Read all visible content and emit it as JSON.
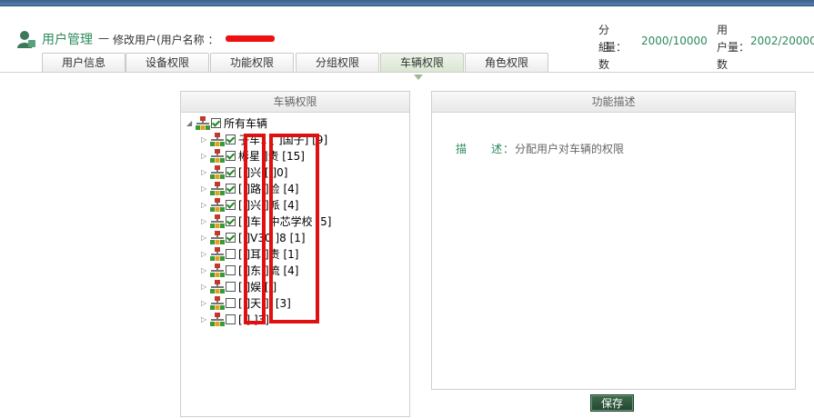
{
  "header": {
    "title": "用户管理",
    "separator": "—",
    "subtitle": "修改用户(用户名称 ：",
    "group_count_label_1": "分組数",
    "group_count_label_2": "量：",
    "group_count_value": "2000/10000",
    "user_count_label_1": "用户数",
    "user_count_label_2": "量：",
    "user_count_value": "2002/20000"
  },
  "tabs": [
    {
      "label": "用户信息"
    },
    {
      "label": "设备权限"
    },
    {
      "label": "功能权限"
    },
    {
      "label": "分组权限"
    },
    {
      "label": "车辆权限",
      "active": true
    },
    {
      "label": "角色权限"
    }
  ],
  "vehicle_panel": {
    "title": "车辆权限",
    "root": {
      "label": "所有车辆",
      "checked": true,
      "expanded": true
    },
    "nodes": [
      {
        "label": "子车1 [ ]国子] [9]",
        "checked": true
      },
      {
        "label": "彬星 ]责 [15]",
        "checked": true
      },
      {
        "label": "[ ]兴 [ ]0]",
        "checked": true
      },
      {
        "label": "[ ]路 ]检 [4]",
        "checked": true
      },
      {
        "label": "[ ]兴 ]派 [4]",
        "checked": true
      },
      {
        "label": "[ ]车] 中芯学校 [5]",
        "checked": true
      },
      {
        "label": "[ ]V30 ]8 [1]",
        "checked": true
      },
      {
        "label": "[ ]耳 ]责 [1]",
        "checked": false
      },
      {
        "label": "[ ]东 ]流 [4]",
        "checked": false
      },
      {
        "label": "[ ]娱 [ ]",
        "checked": false
      },
      {
        "label": "[ ]天 ]i [3]",
        "checked": false
      },
      {
        "label": "[ ] ]3]",
        "checked": false
      }
    ]
  },
  "desc_panel": {
    "title": "功能描述",
    "label": "描　　述：",
    "text": "分配用户对车辆的权限"
  },
  "save_label": "保存",
  "colors": {
    "accent_green": "#2c8a5e",
    "redaction": "#e01010",
    "button_bg": "#2e5a3d"
  }
}
